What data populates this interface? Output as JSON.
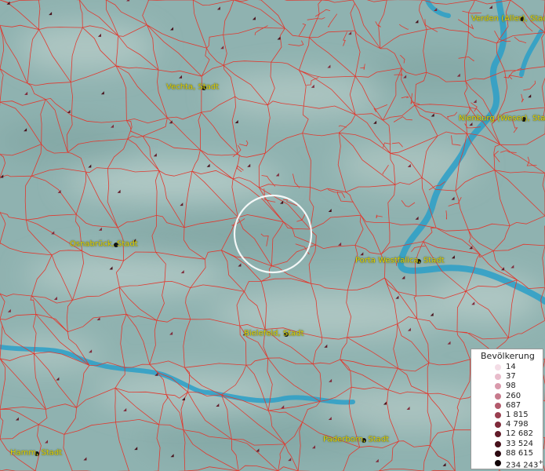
{
  "map": {
    "colors": {
      "base": "#8fb2b0",
      "border": "#e0392f",
      "river": "#2a9fc8",
      "label": "#e6d600",
      "focus_circle": "#ffffff"
    },
    "cities": [
      {
        "id": "verden",
        "label": "Verden (Aller), Stadt"
      },
      {
        "id": "vechta",
        "label": "Vechta, Stadt"
      },
      {
        "id": "nienburg",
        "label": "Nienburg (Weser), Stadt"
      },
      {
        "id": "osnabrueck",
        "label": "Osnabrück, Stadt"
      },
      {
        "id": "porta",
        "label": "Porta Westfalica, Stadt"
      },
      {
        "id": "bielefeld",
        "label": "Bielefeld, Stadt"
      },
      {
        "id": "paderborn",
        "label": "Paderborn, Stadt"
      },
      {
        "id": "hamm",
        "label": "Hamm, Stadt"
      }
    ]
  },
  "legend": {
    "title": "Bevölkerung",
    "items": [
      {
        "label": "14",
        "color": "#f4dde6"
      },
      {
        "label": "37",
        "color": "#e8bccb"
      },
      {
        "label": "98",
        "color": "#d99aac"
      },
      {
        "label": "260",
        "color": "#c77a8c"
      },
      {
        "label": "687",
        "color": "#b35a6c"
      },
      {
        "label": "1 815",
        "color": "#9a3f50"
      },
      {
        "label": "4 798",
        "color": "#7f2a3a"
      },
      {
        "label": "12 682",
        "color": "#621c29"
      },
      {
        "label": "33 524",
        "color": "#47111b"
      },
      {
        "label": "88 615",
        "color": "#2c0a10"
      },
      {
        "label": "234 243",
        "color": "#120406",
        "suffix": "+"
      }
    ]
  }
}
